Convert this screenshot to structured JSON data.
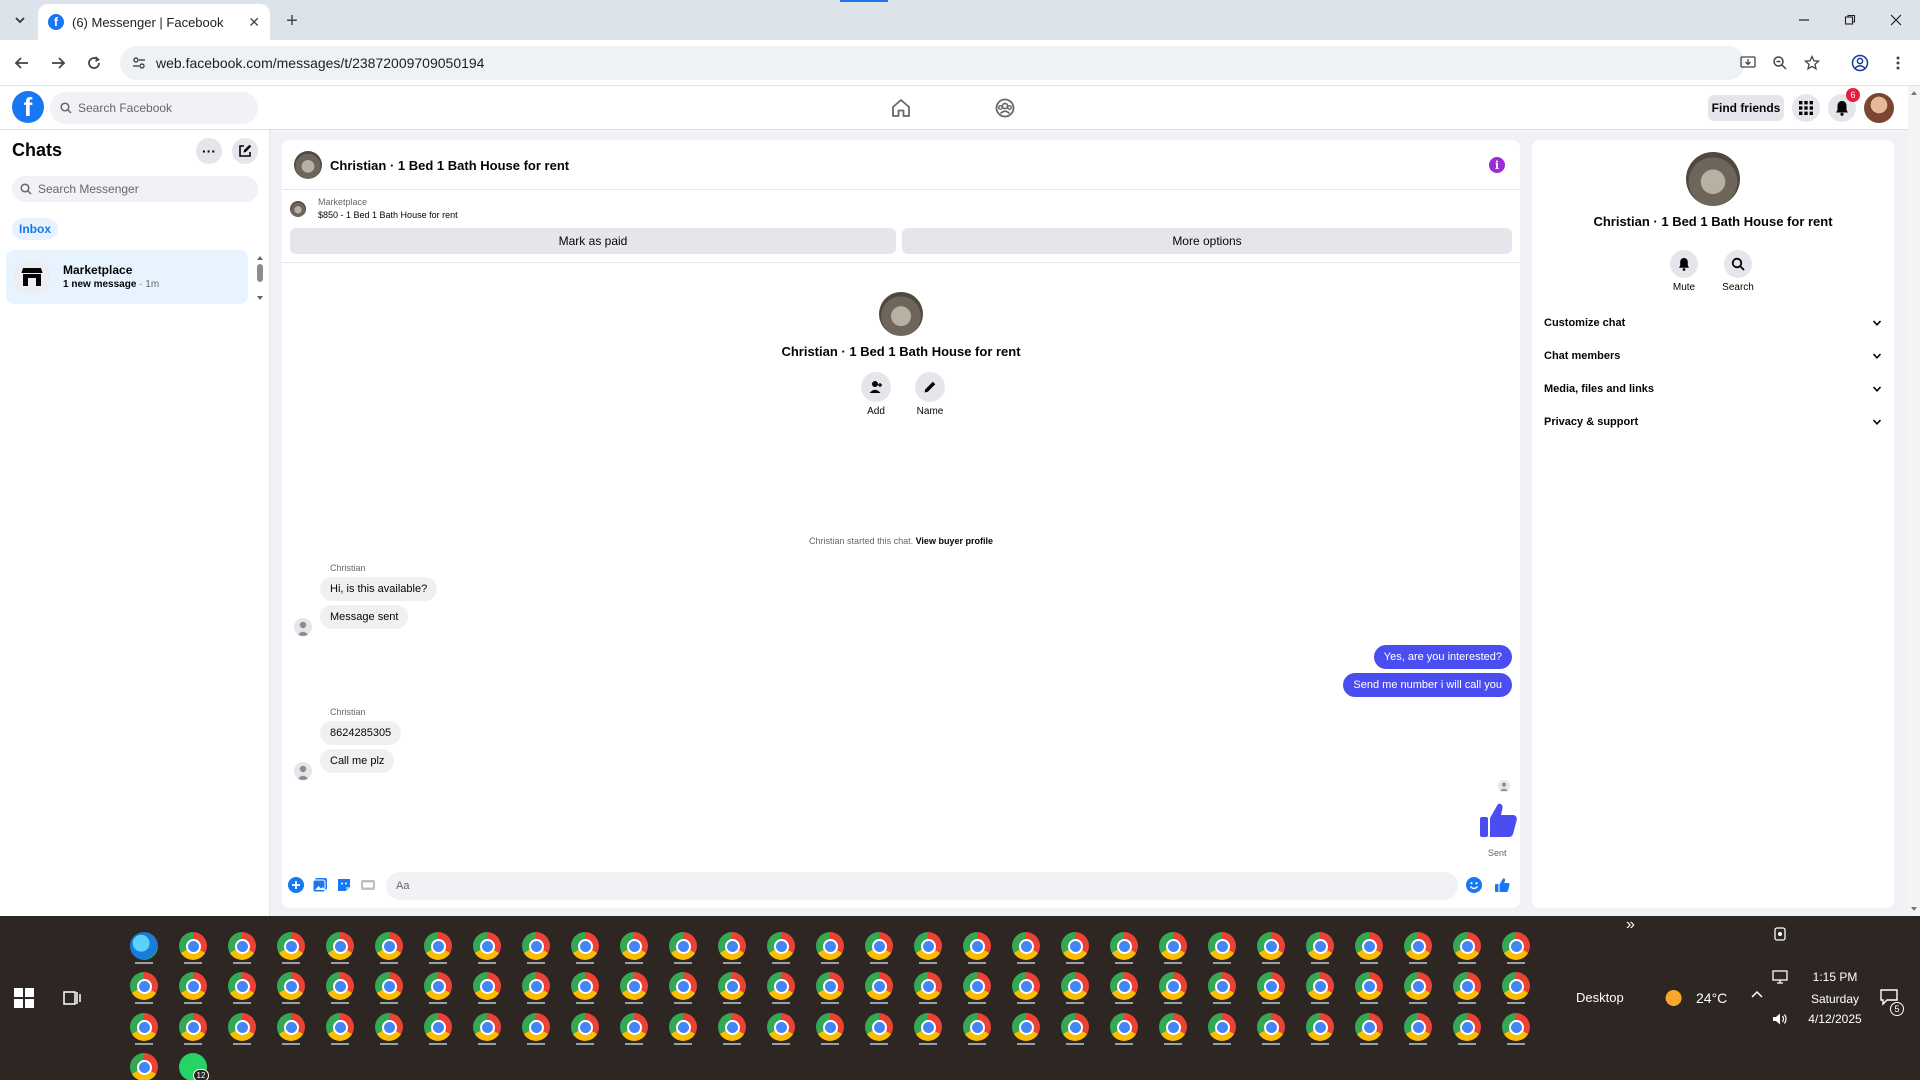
{
  "browser": {
    "tab_title": "(6) Messenger | Facebook",
    "tab_close": "✕",
    "new_tab": "+",
    "url": "web.facebook.com/messages/t/23872009709050194"
  },
  "fb": {
    "logo": "f",
    "search_placeholder": "Search Facebook",
    "find_friends": "Find friends",
    "notification_count": "6"
  },
  "sidebar": {
    "title": "Chats",
    "more": "···",
    "search_placeholder": "Search Messenger",
    "inbox": "Inbox",
    "thread": {
      "name": "Marketplace",
      "preview": "1 new message",
      "time": " · 1m"
    }
  },
  "conversation": {
    "title": "Christian · 1 Bed 1 Bath House for rent",
    "info_icon": "i",
    "marketplace_label": "Marketplace",
    "listing": "$850 - 1 Bed 1 Bath House for rent",
    "mark_paid": "Mark as paid",
    "more_options": "More options",
    "intro_name": "Christian · 1 Bed 1 Bath House for rent",
    "add_label": "Add",
    "name_label": "Name",
    "started_text": "Christian started this chat. ",
    "view_buyer": "View buyer profile",
    "messages": [
      {
        "sender": "Christian",
        "text": "Hi, is this available?"
      },
      {
        "text": "Message sent"
      },
      {
        "text": "Yes, are you interested?"
      },
      {
        "text": "Send me number i will call you"
      },
      {
        "sender": "Christian",
        "text": "8624285305"
      },
      {
        "text": "Call me plz"
      }
    ],
    "sent_label": "Sent",
    "composer_placeholder": "Aa"
  },
  "info_panel": {
    "name": "Christian · 1 Bed 1 Bath House for rent",
    "mute": "Mute",
    "search": "Search",
    "rows": [
      "Customize chat",
      "Chat members",
      "Media, files and links",
      "Privacy & support"
    ]
  },
  "taskbar": {
    "more": "»",
    "whatsapp_badge": "12",
    "desktop": "Desktop",
    "temperature": "24°C",
    "time": "1:15 PM",
    "day": "Saturday",
    "date": "4/12/2025",
    "notification_count": "5"
  },
  "colors": {
    "facebook_blue": "#1877f2",
    "outgoing_bubble": "#4a4ef0",
    "info_purple": "#9b2bd8",
    "badge_red": "#e41e3f"
  }
}
